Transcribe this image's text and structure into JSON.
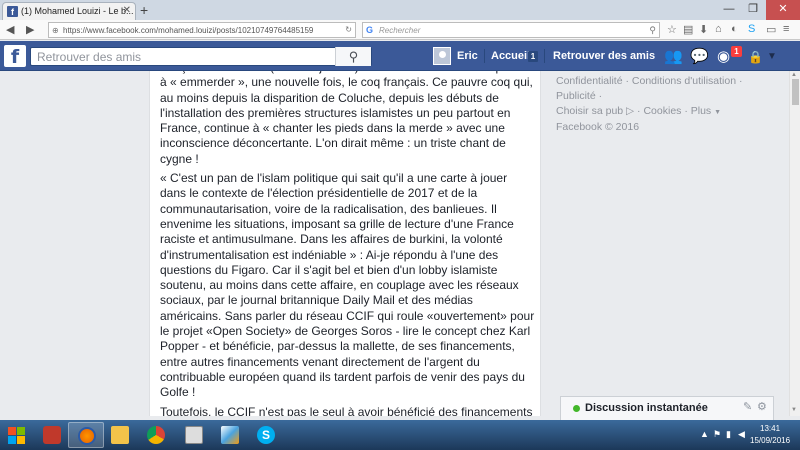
{
  "browser": {
    "tab_title": "(1) Mohamed Louizi - Le b...",
    "tab_favicon": "f",
    "new_tab": "+",
    "window_min": "—",
    "window_max": "❐",
    "window_close": "✕",
    "url": "https://www.facebook.com/mohamed.louizi/posts/10210749764485159",
    "search_placeholder": "Rechercher",
    "search_engine": "G"
  },
  "facebook": {
    "logo": "f",
    "search_placeholder": "Retrouver des amis",
    "user_name": "Eric",
    "home_label": "Accueil",
    "home_count": "1",
    "find_friends": "Retrouver des amis",
    "notification_count": "1"
  },
  "post": {
    "paragraphs": [
      "français musulmans (souvent jeunes) et surtout en terme de capacité à « emmerder », une nouvelle fois, le coq français. Ce pauvre coq qui, au moins depuis la disparition de Coluche, depuis les débuts de l'installation des premières structures islamistes un peu partout en France, continue à « chanter les pieds dans la merde » avec une inconscience déconcertante. L'on dirait même : un triste chant de cygne !",
      "« C'est un pan de l'islam politique qui sait qu'il a une carte à jouer dans le contexte de l'élection présidentielle de 2017 et de la communautarisation, voire de la radicalisation, des banlieues. Il envenime les situations, imposant sa grille de lecture d'une France raciste et antimusulmane. Dans les affaires de burkini, la volonté d'instrumentalisation est indéniable » : Ai-je répondu à l'une des questions du Figaro. Car il s'agit bel et bien d'un lobby islamiste soutenu, au moins dans cette affaire, en couplage avec les réseaux sociaux, par le journal britannique Daily Mail et des médias américains. Sans parler du réseau CCIF qui roule «ouvertement» pour le projet «Open Society» de Georges Soros - lire le concept chez Karl Popper - et bénéficie, par-dessus la mallette, de ses financements, entre autres financements venant directement de l'argent du contribuable européen quand ils tardent parfois de venir des pays du Golfe !",
      "Toutefois, le CCIF n'est pas le seul à avoir bénéficié des financements obscurs du milliardaire très controversé Georges Soros. Le sociologue musulman franco-italien, Omero Marongiu-Perria, pour ne pas le citer, a aussi bénéficié de ces financements dans le cadre d'un projet réalisé"
    ]
  },
  "sidebar": {
    "privacy": "Confidentialité",
    "terms": "Conditions d'utilisation",
    "advertising": "Publicité",
    "ad_choices": "Choisir sa pub",
    "cookies": "Cookies",
    "more": "Plus",
    "copyright": "Facebook © 2016"
  },
  "chat": {
    "label": "Discussion instantanée"
  },
  "taskbar": {
    "time": "13:41",
    "date": "15/09/2016"
  }
}
